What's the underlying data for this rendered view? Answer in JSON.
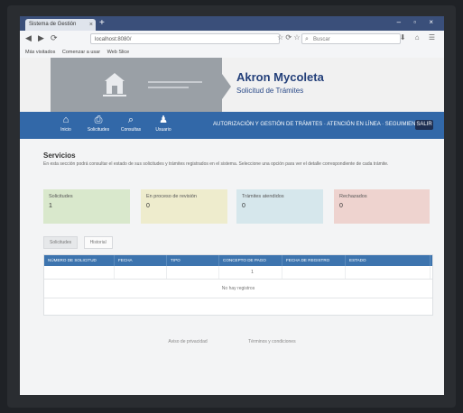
{
  "browser": {
    "tab_title": "Sistema de Gestión",
    "tab_close": "×",
    "new_tab": "+",
    "window_controls": "– ▫ ×",
    "nav_back": "◀",
    "nav_forward": "▶",
    "nav_reload": "⟳",
    "url": "localhost:8080/",
    "url_icons": "☆ ⟳ ☆",
    "search_placeholder": "Buscar",
    "search_icon": "⌕",
    "toolbar_icons": "⬇ ⌂ ☰",
    "bookmarks": [
      "Más visitados",
      "Comenzar a usar",
      "Web Slice"
    ]
  },
  "header": {
    "title": "Akron Mycoleta",
    "subtitle": "Solicitud de Trámites"
  },
  "menubar": {
    "items": [
      {
        "icon": "⌂",
        "label": "Inicio"
      },
      {
        "icon": "⎙",
        "label": "Solicitudes"
      },
      {
        "icon": "⌕",
        "label": "Consultas"
      },
      {
        "icon": "♟",
        "label": "Usuario"
      }
    ],
    "banner_text": "AUTORIZACIÓN Y GESTIÓN DE TRÁMITES · ATENCIÓN EN LÍNEA · SEGUIMIENTO",
    "badge": "SALIR"
  },
  "main": {
    "title": "Servicios",
    "description": "En esta sección podrá consultar el estado de sus solicitudes y trámites registrados en el sistema. Seleccione una opción para ver el detalle correspondiente de cada trámite.",
    "cards": [
      {
        "label": "Solicitudes",
        "value": "1"
      },
      {
        "label": "En proceso de revisión",
        "value": "0"
      },
      {
        "label": "Trámites atendidos",
        "value": "0"
      },
      {
        "label": "Rechazados",
        "value": "0"
      }
    ],
    "subtabs": [
      "Solicitudes",
      "Historial"
    ],
    "table": {
      "columns": [
        "NÚMERO DE SOLICITUD",
        "FECHA",
        "TIPO",
        "CONCEPTO DE PAGO",
        "FECHA DE REGISTRO",
        "ESTADO"
      ],
      "row_values": [
        "",
        "",
        "",
        "1",
        "",
        ""
      ],
      "empty_text": "No hay registros"
    },
    "footer": [
      "Aviso de privacidad",
      "Términos y condiciones"
    ]
  }
}
